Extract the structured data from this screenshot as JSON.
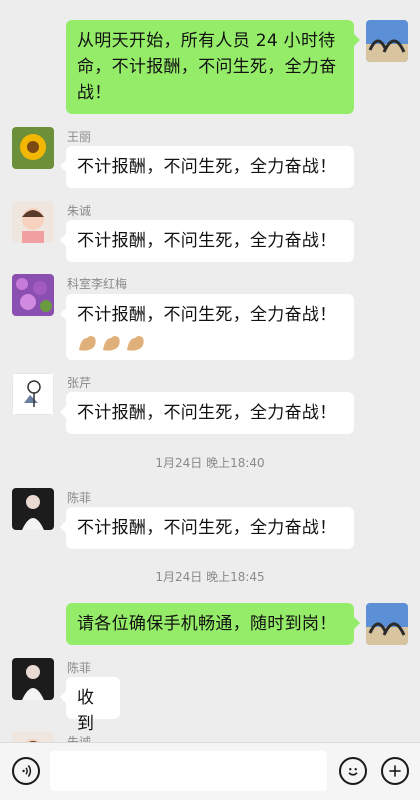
{
  "messages": [
    {
      "sender": "",
      "text": "从明天开始，所有人员 24 小时待命，不计报酬，不问生死，全力奋战！"
    },
    {
      "sender": "王丽",
      "text": "不计报酬，不问生死，全力奋战！"
    },
    {
      "sender": "朱诚",
      "text": "不计报酬，不问生死，全力奋战！"
    },
    {
      "sender": "科室李红梅",
      "text": "不计报酬，不问生死，全力奋战！",
      "emoji": "flexed-biceps x3"
    },
    {
      "sender": "张芹",
      "text": "不计报酬，不问生死，全力奋战！"
    },
    {
      "sender": "陈菲",
      "text": "不计报酬，不问生死，全力奋战！"
    },
    {
      "sender": "",
      "text": "请各位确保手机畅通，随时到岗！"
    },
    {
      "sender": "陈菲",
      "text": "收到"
    },
    {
      "sender": "朱诚",
      "text": ""
    }
  ],
  "timestamps": [
    "1月24日 晚上18:40",
    "1月24日 晚上18:45"
  ],
  "me_message": {
    "line1": "从明天开始，所有人员 24 小时待",
    "line2": "命，不计报酬，不问生死，全力奋",
    "line3": "战！"
  },
  "colors": {
    "me_bubble": "#95ec69",
    "other_bubble": "#ffffff",
    "background": "#ededed"
  },
  "icons": {
    "voice": "voice-icon",
    "emoji": "smiley-icon",
    "plus": "plus-icon"
  }
}
